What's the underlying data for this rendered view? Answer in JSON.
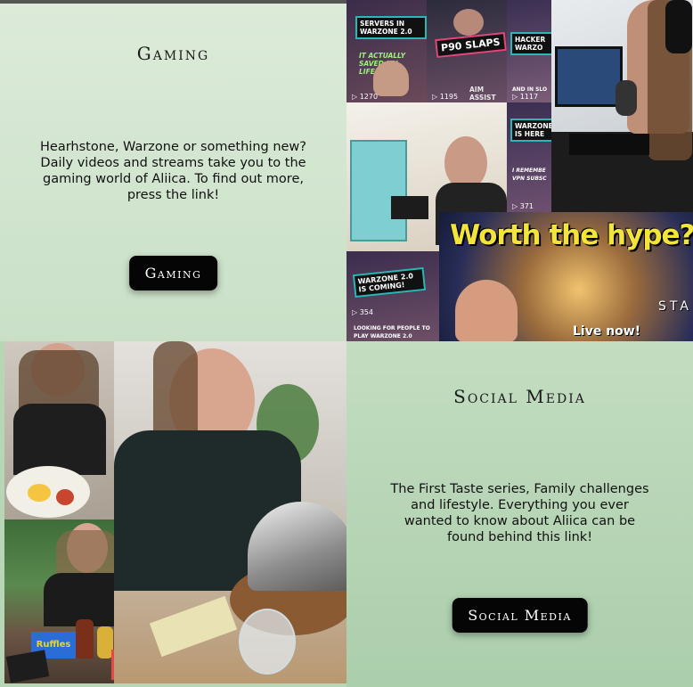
{
  "gaming": {
    "heading": "Gaming",
    "description": "Hearhstone, Warzone or something new? Daily videos and streams take you to the gaming world of Aliica. To find out more, press the link!",
    "button_label": "Gaming",
    "thumbnails": [
      {
        "label": "Servers in Warzone 2.0",
        "sub": "It actually saved my life",
        "views": "1270"
      },
      {
        "label": "P90 Slaps",
        "sub": "Aim assist",
        "views": "1195"
      },
      {
        "label": "Hacker Warzo",
        "sub": "And in slo",
        "views": "1117"
      },
      {
        "label": "Warzone is here",
        "sub": "I remembe VPN subsc",
        "views": "371"
      },
      {
        "label": "Warzone 2.0 is coming!",
        "sub": "Looking for people to play Warzone 2.0",
        "views": "354"
      }
    ],
    "stream_title": "Worth the hype?",
    "stream_badge": "Live now!",
    "stream_side": "STA"
  },
  "social": {
    "heading": "Social Media",
    "description": "The First Taste series, Family challenges and lifestyle. Everything you ever wanted to know about Aliica can be found behind this link!",
    "button_label": "Social Media",
    "snack_label": "Ruffles"
  },
  "colors": {
    "button_bg": "#050505",
    "panel_green": "#c9e0c7",
    "thumb_teal": "#2ab7b7",
    "thumb_pink": "#e0477d",
    "hype_yellow": "#f2e43a"
  }
}
